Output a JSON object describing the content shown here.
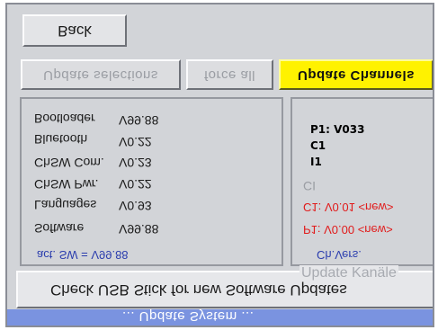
{
  "header": {
    "back_label": "Back"
  },
  "actions": {
    "update_selections_label": "Update selections",
    "force_all_label": "force all",
    "update_channels_label": "Update Channels"
  },
  "software_panel": {
    "legend": "act. SW = V99.88",
    "rows": [
      {
        "name": "Bootloader",
        "value": "V99.88"
      },
      {
        "name": "Bluetooth",
        "value": "V0.22"
      },
      {
        "name": "ChSW Com.",
        "value": "V0.23"
      },
      {
        "name": "ChSW Pwr.",
        "value": "V0.22"
      },
      {
        "name": "Languages",
        "value": "V0.93"
      },
      {
        "name": "Software",
        "value": "V99.88"
      }
    ]
  },
  "channel_panel": {
    "legend": "Ch.Vers.",
    "overlay_p1": "P1: V033",
    "overlay_c1": "C1",
    "overlay_i1": "I1",
    "ci_label": "CI",
    "c1_line": "C1: V0.01 <new>",
    "p1_line": "P1: V0.00 <new>"
  },
  "bottom": {
    "check_usb_label": "Check USB Stick for new Software Updates",
    "update_kanale_label": "Update Kanäle"
  },
  "status_bar": {
    "text": "... Update System ..."
  },
  "colors": {
    "accent_yellow": "#fff200",
    "legend_blue": "#2b3dae",
    "new_red": "#e11b1b",
    "status_blue": "#7a93e0"
  }
}
